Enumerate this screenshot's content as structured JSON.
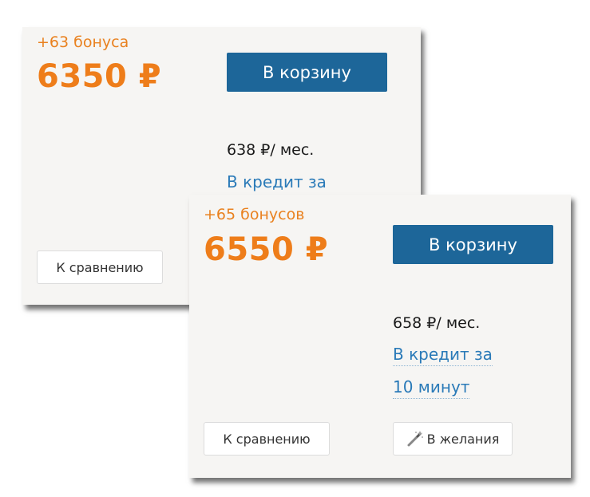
{
  "card_back": {
    "bonus": "+63 бонуса",
    "price": "6350 ₽",
    "cart_label": "В корзину",
    "monthly": "638 ₽/ мес.",
    "credit_label": "В кредит за",
    "compare_label": "К сравнению"
  },
  "card_front": {
    "bonus": "+65 бонусов",
    "price": "6550 ₽",
    "cart_label": "В корзину",
    "monthly": "658 ₽/ мес.",
    "credit_line1": "В кредит за",
    "credit_line2": "10 минут",
    "compare_label": "К сравнению",
    "wishlist_label": "В желания",
    "wishlist_icon": "magic-wand-icon"
  },
  "colors": {
    "accent_orange": "#ee7d1a",
    "button_blue": "#1d6699",
    "link_blue": "#2a7ab8",
    "card_background": "#f6f5f3"
  }
}
